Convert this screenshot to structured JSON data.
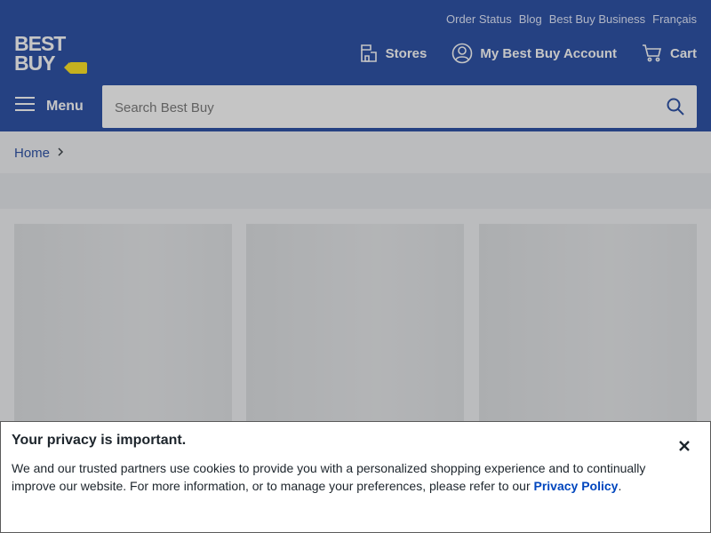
{
  "header": {
    "util_links": [
      "Order Status",
      "Blog",
      "Best Buy Business",
      "Français"
    ],
    "logo_line1": "BEST",
    "logo_line2": "BUY",
    "stores_label": "Stores",
    "account_label": "My Best Buy Account",
    "cart_label": "Cart",
    "menu_label": "Menu"
  },
  "search": {
    "placeholder": "Search Best Buy"
  },
  "breadcrumb": {
    "home": "Home"
  },
  "privacy": {
    "title": "Your privacy is important.",
    "body": "We and our trusted partners use cookies to provide you with a personalized shopping experience and to continually improve our website. For more information, or to manage your preferences, please refer to our ",
    "link": "Privacy Policy",
    "suffix": "."
  },
  "colors": {
    "brand_blue": "#0a3598",
    "tag_yellow": "#ffe000",
    "link_blue": "#0046be"
  }
}
